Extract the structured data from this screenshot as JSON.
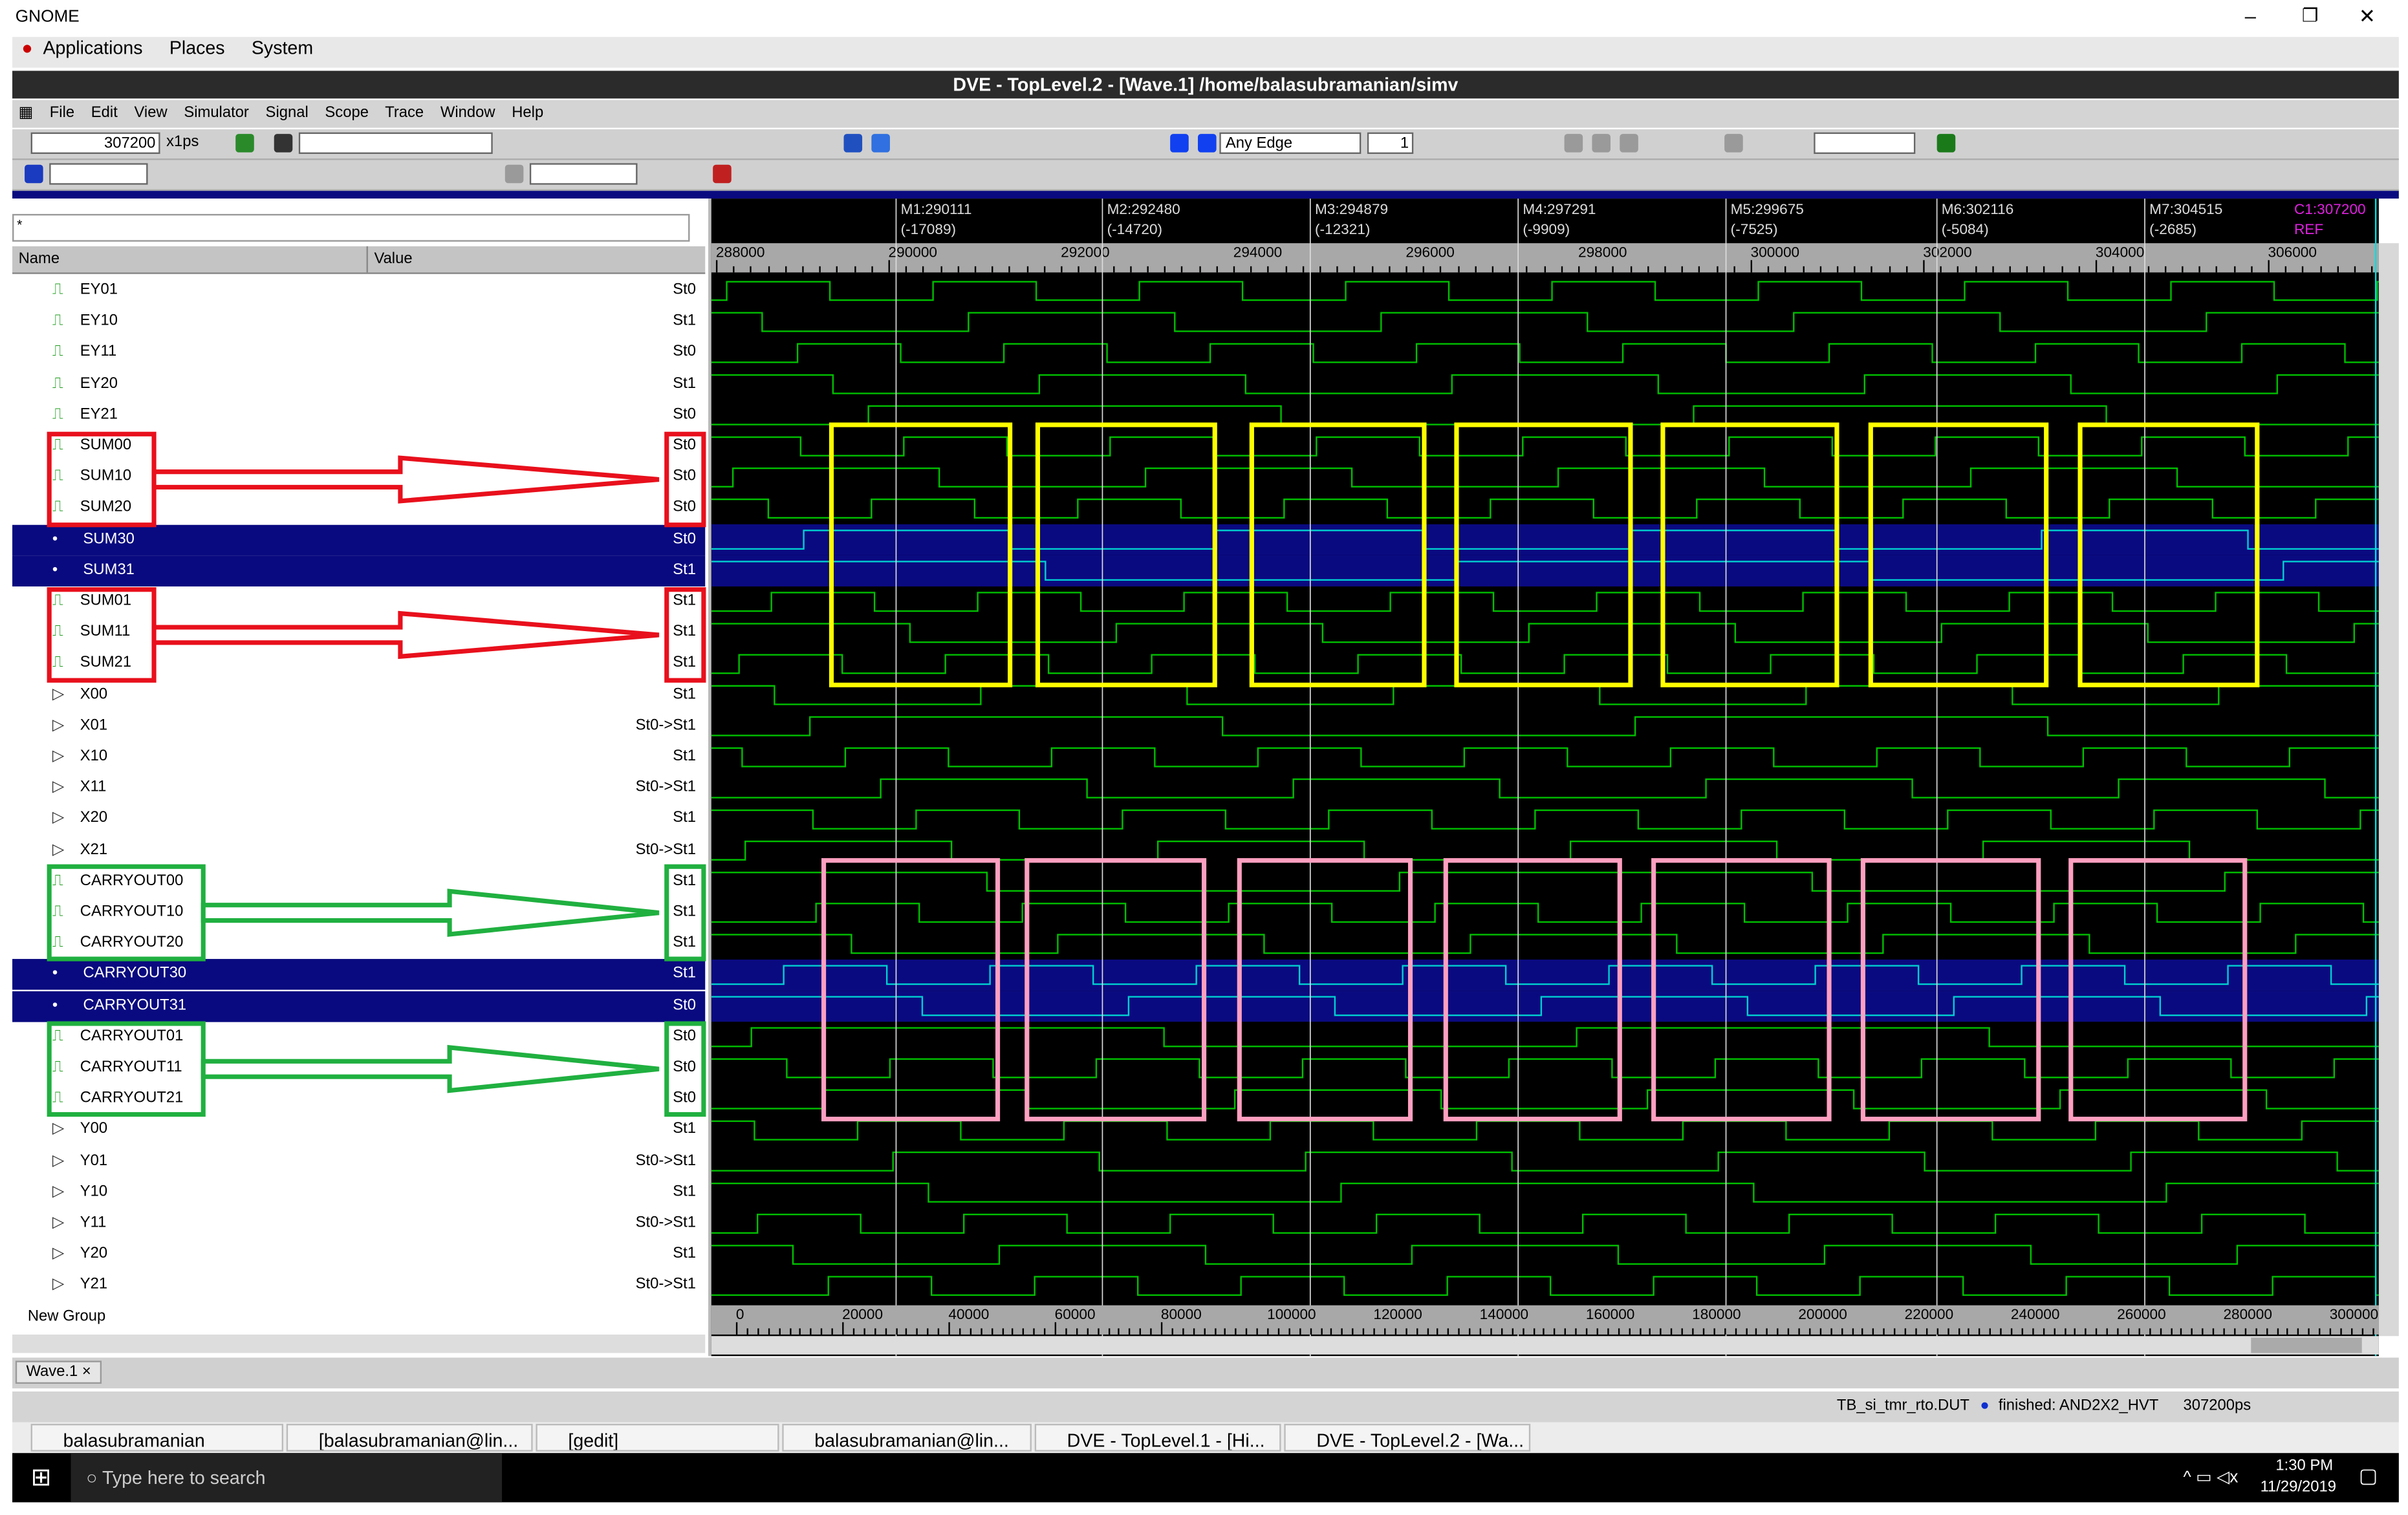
{
  "os_title": "GNOME",
  "gnome_menu": [
    "Applications",
    "Places",
    "System"
  ],
  "window_title": "DVE - TopLevel.2 - [Wave.1]  /home/balasubramanian/simv",
  "menu": [
    "File",
    "Edit",
    "View",
    "Simulator",
    "Signal",
    "Scope",
    "Trace",
    "Window",
    "Help"
  ],
  "toolbar": {
    "time": "307200",
    "unit": "x1ps",
    "edge": "Any Edge",
    "count": "1"
  },
  "filter": {
    "value": "*"
  },
  "columns": {
    "name": "Name",
    "value": "Value"
  },
  "signals": [
    {
      "name": "EY01",
      "value": "St0",
      "kind": "wire"
    },
    {
      "name": "EY10",
      "value": "St1",
      "kind": "wire"
    },
    {
      "name": "EY11",
      "value": "St0",
      "kind": "wire"
    },
    {
      "name": "EY20",
      "value": "St1",
      "kind": "wire"
    },
    {
      "name": "EY21",
      "value": "St0",
      "kind": "wire"
    },
    {
      "name": "SUM00",
      "value": "St0",
      "kind": "wire"
    },
    {
      "name": "SUM10",
      "value": "St0",
      "kind": "wire"
    },
    {
      "name": "SUM20",
      "value": "St0",
      "kind": "wire"
    },
    {
      "name": "SUM30",
      "value": "St0",
      "kind": "wire",
      "selected": true
    },
    {
      "name": "SUM31",
      "value": "St1",
      "kind": "wire",
      "selected": true
    },
    {
      "name": "SUM01",
      "value": "St1",
      "kind": "wire"
    },
    {
      "name": "SUM11",
      "value": "St1",
      "kind": "wire"
    },
    {
      "name": "SUM21",
      "value": "St1",
      "kind": "wire"
    },
    {
      "name": "X00",
      "value": "St1",
      "kind": "input"
    },
    {
      "name": "X01",
      "value": "St0->St1",
      "kind": "input"
    },
    {
      "name": "X10",
      "value": "St1",
      "kind": "input"
    },
    {
      "name": "X11",
      "value": "St0->St1",
      "kind": "input"
    },
    {
      "name": "X20",
      "value": "St1",
      "kind": "input"
    },
    {
      "name": "X21",
      "value": "St0->St1",
      "kind": "input"
    },
    {
      "name": "CARRYOUT00",
      "value": "St1",
      "kind": "wire"
    },
    {
      "name": "CARRYOUT10",
      "value": "St1",
      "kind": "wire"
    },
    {
      "name": "CARRYOUT20",
      "value": "St1",
      "kind": "wire"
    },
    {
      "name": "CARRYOUT30",
      "value": "St1",
      "kind": "wire",
      "selected": true
    },
    {
      "name": "CARRYOUT31",
      "value": "St0",
      "kind": "wire",
      "selected": true
    },
    {
      "name": "CARRYOUT01",
      "value": "St0",
      "kind": "wire"
    },
    {
      "name": "CARRYOUT11",
      "value": "St0",
      "kind": "wire"
    },
    {
      "name": "CARRYOUT21",
      "value": "St0",
      "kind": "wire"
    },
    {
      "name": "Y00",
      "value": "St1",
      "kind": "input"
    },
    {
      "name": "Y01",
      "value": "St0->St1",
      "kind": "input"
    },
    {
      "name": "Y10",
      "value": "St1",
      "kind": "input"
    },
    {
      "name": "Y11",
      "value": "St0->St1",
      "kind": "input"
    },
    {
      "name": "Y20",
      "value": "St1",
      "kind": "input"
    },
    {
      "name": "Y21",
      "value": "St0->St1",
      "kind": "input"
    }
  ],
  "group_label": "New Group",
  "markers": [
    {
      "label": "M1:290111",
      "delta": "(-17089)"
    },
    {
      "label": "M2:292480",
      "delta": "(-14720)"
    },
    {
      "label": "M3:294879",
      "delta": "(-12321)"
    },
    {
      "label": "M4:297291",
      "delta": "(-9909)"
    },
    {
      "label": "M5:299675",
      "delta": "(-7525)"
    },
    {
      "label": "M6:302116",
      "delta": "(-5084)"
    },
    {
      "label": "M7:304515",
      "delta": "(-2685)"
    }
  ],
  "cursor": {
    "label": "C1:307200",
    "ref": "REF"
  },
  "top_ruler": [
    "288000",
    "290000",
    "292000",
    "294000",
    "296000",
    "298000",
    "300000",
    "302000",
    "304000",
    "306000"
  ],
  "bottom_ruler": [
    "0",
    "20000",
    "40000",
    "60000",
    "80000",
    "100000",
    "120000",
    "140000",
    "160000",
    "180000",
    "200000",
    "220000",
    "240000",
    "260000",
    "280000",
    "300000"
  ],
  "tab": "Wave.1",
  "status": {
    "scope": "TB_si_tmr_rto.DUT",
    "state": "finished: AND2X2_HVT",
    "time": "307200ps"
  },
  "gnome_tasks": [
    "balasubramanian",
    "[balasubramanian@lin...",
    "[gedit]",
    "balasubramanian@lin...",
    "DVE - TopLevel.1 - [Hi...",
    "DVE - TopLevel.2 - [Wa..."
  ],
  "win": {
    "search": "Type here to search",
    "time": "1:30 PM",
    "date": "11/29/2019"
  },
  "colors": {
    "wave": "#00c000",
    "selected_wave": "#00d0d0",
    "selection": "#0a0a80",
    "sum_box": "#ffff00",
    "carry_box": "#ff9fc0",
    "red": "#e8101c",
    "green": "#20b040"
  }
}
